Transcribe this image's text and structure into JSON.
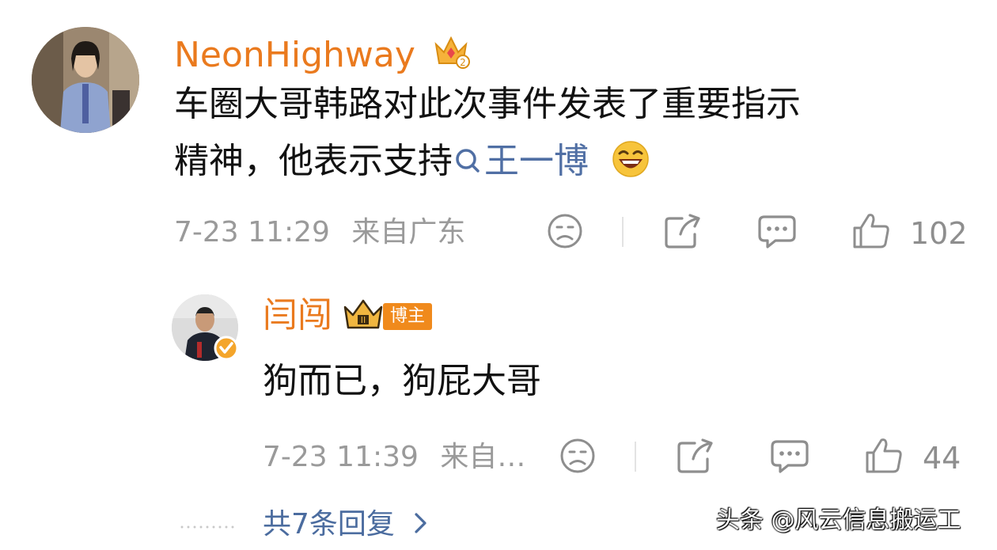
{
  "comment": {
    "username": "NeonHighway",
    "text_line1": "车圈大哥韩路对此次事件发表了重要指示",
    "text_line2_prefix": "精神，他表示支持",
    "topic": "王一博",
    "emoji": "laughing-emoji",
    "time": "7-23 11:29",
    "location": "来自广东",
    "likes": "102"
  },
  "reply": {
    "username": "闫闯",
    "badge": "博主",
    "text": "狗而已，狗屁大哥",
    "time": "7-23 11:39",
    "location": "来自…",
    "likes": "44"
  },
  "more_replies": {
    "label": "共7条回复"
  },
  "watermark": {
    "text": "头条 @风云信息搬运工"
  },
  "colors": {
    "username": "#ea7a1e",
    "topic": "#506fa4",
    "meta": "#9a9a9a",
    "badge": "#f08a1c"
  }
}
